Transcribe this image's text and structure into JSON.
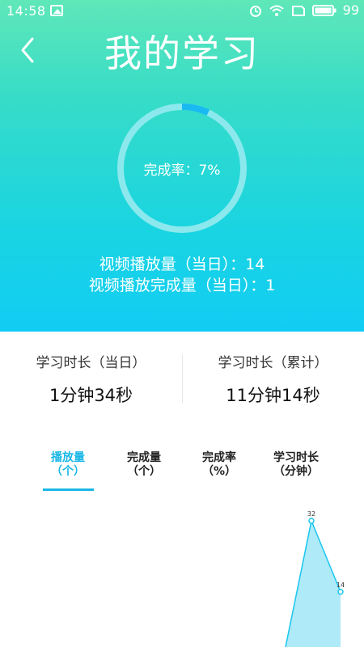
{
  "status_bar": {
    "time": "14:58",
    "battery": "99",
    "icons": [
      "image-icon",
      "alarm-icon",
      "wifi-icon",
      "sim-icon",
      "battery-icon"
    ]
  },
  "header": {
    "title": "我的学习",
    "back_icon": "chevron-left-icon"
  },
  "progress": {
    "label": "完成率：7%",
    "value_percent": 7,
    "track_color": "#8be9ee",
    "fill_color": "#19b9f2"
  },
  "summary": {
    "plays_today": "视频播放量（当日）：14",
    "completed_today": "视频播放完成量（当日）：1"
  },
  "stats": {
    "today": {
      "label": "学习时长（当日）",
      "value": "1分钟34秒"
    },
    "total": {
      "label": "学习时长（累计）",
      "value": "11分钟14秒"
    }
  },
  "tabs": [
    {
      "line1": "播放量",
      "line2": "（个）",
      "active": true
    },
    {
      "line1": "完成量",
      "line2": "（个）",
      "active": false
    },
    {
      "line1": "完成率",
      "line2": "（%）",
      "active": false
    },
    {
      "line1": "学习时长",
      "line2": "（分钟）",
      "active": false
    }
  ],
  "chart_data": {
    "type": "area",
    "series": [
      {
        "values": [
          0,
          32,
          14
        ]
      }
    ],
    "point_labels": [
      "32",
      "14"
    ],
    "ylim": [
      0,
      40
    ],
    "color": "#19c6ee",
    "fill": "#aeeaf7"
  }
}
